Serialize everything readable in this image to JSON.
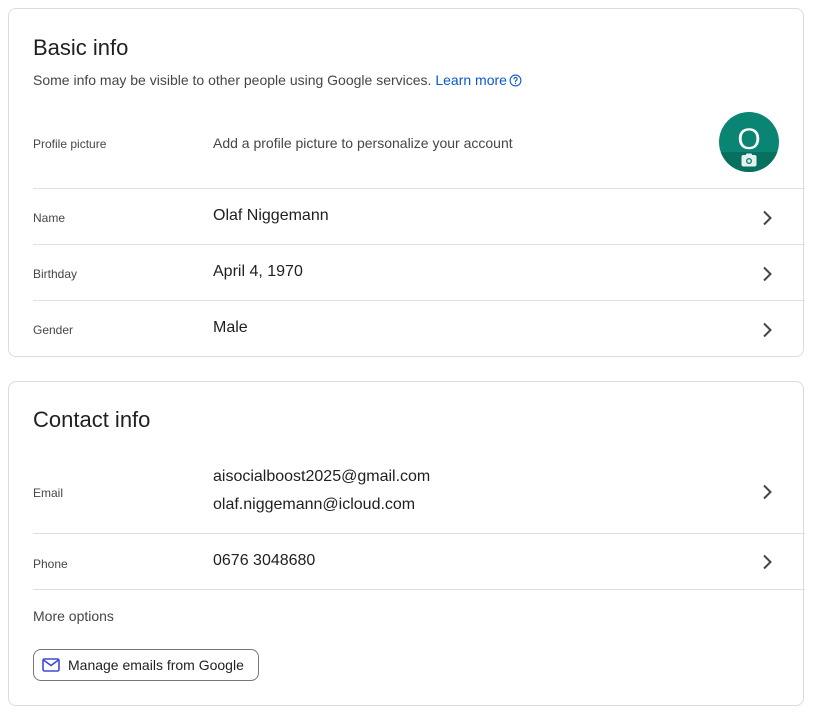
{
  "basic_info": {
    "title": "Basic info",
    "subtitle": "Some info may be visible to other people using Google services.",
    "learn_more": "Learn more",
    "rows": [
      {
        "label": "Profile picture",
        "value": "Add a profile picture to personalize your account"
      },
      {
        "label": "Name",
        "value": "Olaf Niggemann"
      },
      {
        "label": "Birthday",
        "value": "April 4, 1970"
      },
      {
        "label": "Gender",
        "value": "Male"
      }
    ],
    "avatar": {
      "initial": "O",
      "color": "#0a8574"
    }
  },
  "contact_info": {
    "title": "Contact info",
    "rows": [
      {
        "label": "Email",
        "values": [
          "aisocialboost2025@gmail.com",
          "olaf.niggemann@icloud.com"
        ]
      },
      {
        "label": "Phone",
        "value": "0676 3048680"
      }
    ],
    "more_options": "More options",
    "manage_button": "Manage emails from Google"
  },
  "colors": {
    "link": "#0b57d0",
    "border": "#dadce0",
    "icon": "#444746",
    "button_icon": "#3c4bd9"
  },
  "icons": [
    "help-icon",
    "chevron-right-icon",
    "camera-icon",
    "mail-icon"
  ]
}
